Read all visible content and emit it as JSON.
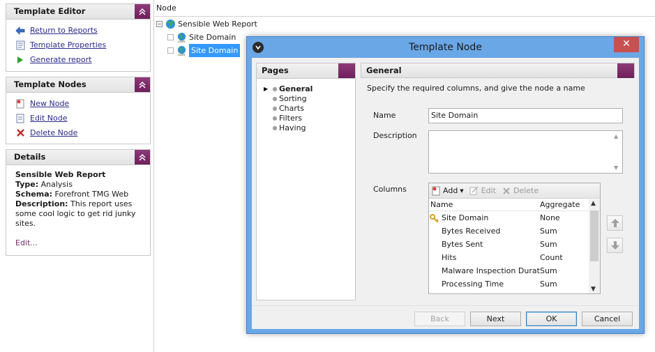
{
  "sidebar": {
    "template_editor": {
      "title": "Template Editor",
      "items": [
        {
          "label": "Return to Reports",
          "icon": "back-arrow-icon"
        },
        {
          "label": "Template Properties",
          "icon": "properties-icon"
        },
        {
          "label": "Generate report",
          "icon": "play-icon"
        }
      ]
    },
    "template_nodes": {
      "title": "Template Nodes",
      "items": [
        {
          "label": "New Node",
          "icon": "new-node-icon"
        },
        {
          "label": "Edit Node",
          "icon": "edit-node-icon"
        },
        {
          "label": "Delete Node",
          "icon": "delete-icon"
        }
      ]
    },
    "details": {
      "title": "Details",
      "report_name": "Sensible Web Report",
      "type_label": "Type:",
      "type_value": "Analysis",
      "schema_label": "Schema:",
      "schema_value": "Forefront TMG Web",
      "description_label": "Description:",
      "description_value": "This report uses some cool logic to get rid junky sites.",
      "edit_link": "Edit..."
    }
  },
  "tree": {
    "header": "Node",
    "root": "Sensible Web Report",
    "children": [
      {
        "label": "Site Domain",
        "selected": false
      },
      {
        "label": "Site Domain",
        "selected": true
      }
    ]
  },
  "dialog": {
    "title": "Template Node",
    "close_glyph": "✕",
    "pages": {
      "title": "Pages",
      "items": [
        "General",
        "Sorting",
        "Charts",
        "Filters",
        "Having"
      ],
      "active": "General"
    },
    "general": {
      "title": "General",
      "description": "Specify the required columns, and give the node a name",
      "name_label": "Name",
      "name_value": "Site Domain",
      "description_label": "Description",
      "description_value": "",
      "columns_label": "Columns",
      "toolbar": {
        "add": "Add",
        "edit": "Edit",
        "delete": "Delete"
      },
      "grid": {
        "headers": [
          "Name",
          "Aggregate"
        ],
        "rows": [
          {
            "name": "Site Domain",
            "aggregate": "None",
            "key": true
          },
          {
            "name": "Bytes Received",
            "aggregate": "Sum",
            "key": false
          },
          {
            "name": "Bytes Sent",
            "aggregate": "Sum",
            "key": false
          },
          {
            "name": "Hits",
            "aggregate": "Count",
            "key": false
          },
          {
            "name": "Malware Inspection Durati...",
            "aggregate": "Sum",
            "key": false
          },
          {
            "name": "Processing Time",
            "aggregate": "Sum",
            "key": false
          }
        ]
      }
    },
    "buttons": {
      "back": "Back",
      "next": "Next",
      "ok": "OK",
      "cancel": "Cancel"
    }
  },
  "colors": {
    "accent": "#6e1f5c",
    "dialog_frame": "#6aa7e6",
    "selection": "#3399ff",
    "close": "#c75050"
  }
}
